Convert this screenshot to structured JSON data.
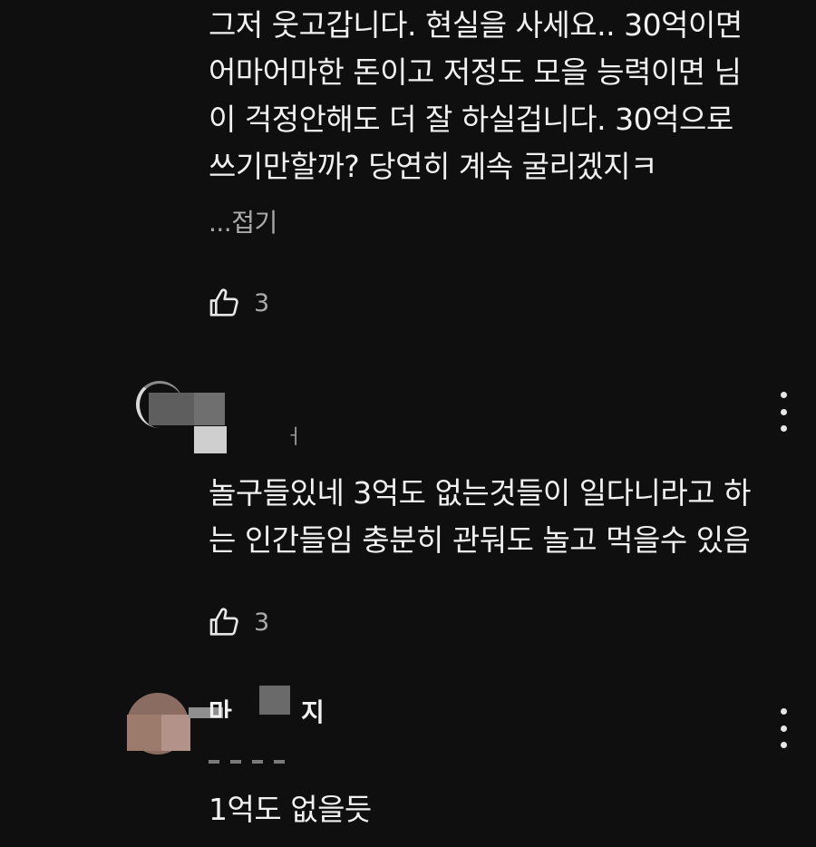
{
  "comments": [
    {
      "text": "그저 웃고갑니다. 현실을 사세요.. 30억이면\n어마어마한 돈이고 저정도 모을 능력이면 님\n이 걱정안해도 더 잘 하실겁니다. 30억으로\n쓰기만할까? 당연히 계속 굴리겠지ㅋ",
      "collapse_label": "...접기",
      "like_count": "3",
      "like_icon": "thumbs-up-icon"
    },
    {
      "author_partial": "ㅓ",
      "text": "놀구들있네 3억도 없는것들이 일다니라고 하\n는 인간들임 충분히 관둬도 놀고 먹을수 있음",
      "like_count": "3",
      "like_icon": "thumbs-up-icon",
      "menu_icon": "more-vert-icon"
    },
    {
      "author_part1": "마",
      "author_part2": "지",
      "text": "1억도 없을듯",
      "menu_icon": "more-vert-icon"
    }
  ],
  "colors": {
    "background": "#0f0f0f",
    "text": "#f1f1f1",
    "secondary_text": "#aaaaaa"
  }
}
